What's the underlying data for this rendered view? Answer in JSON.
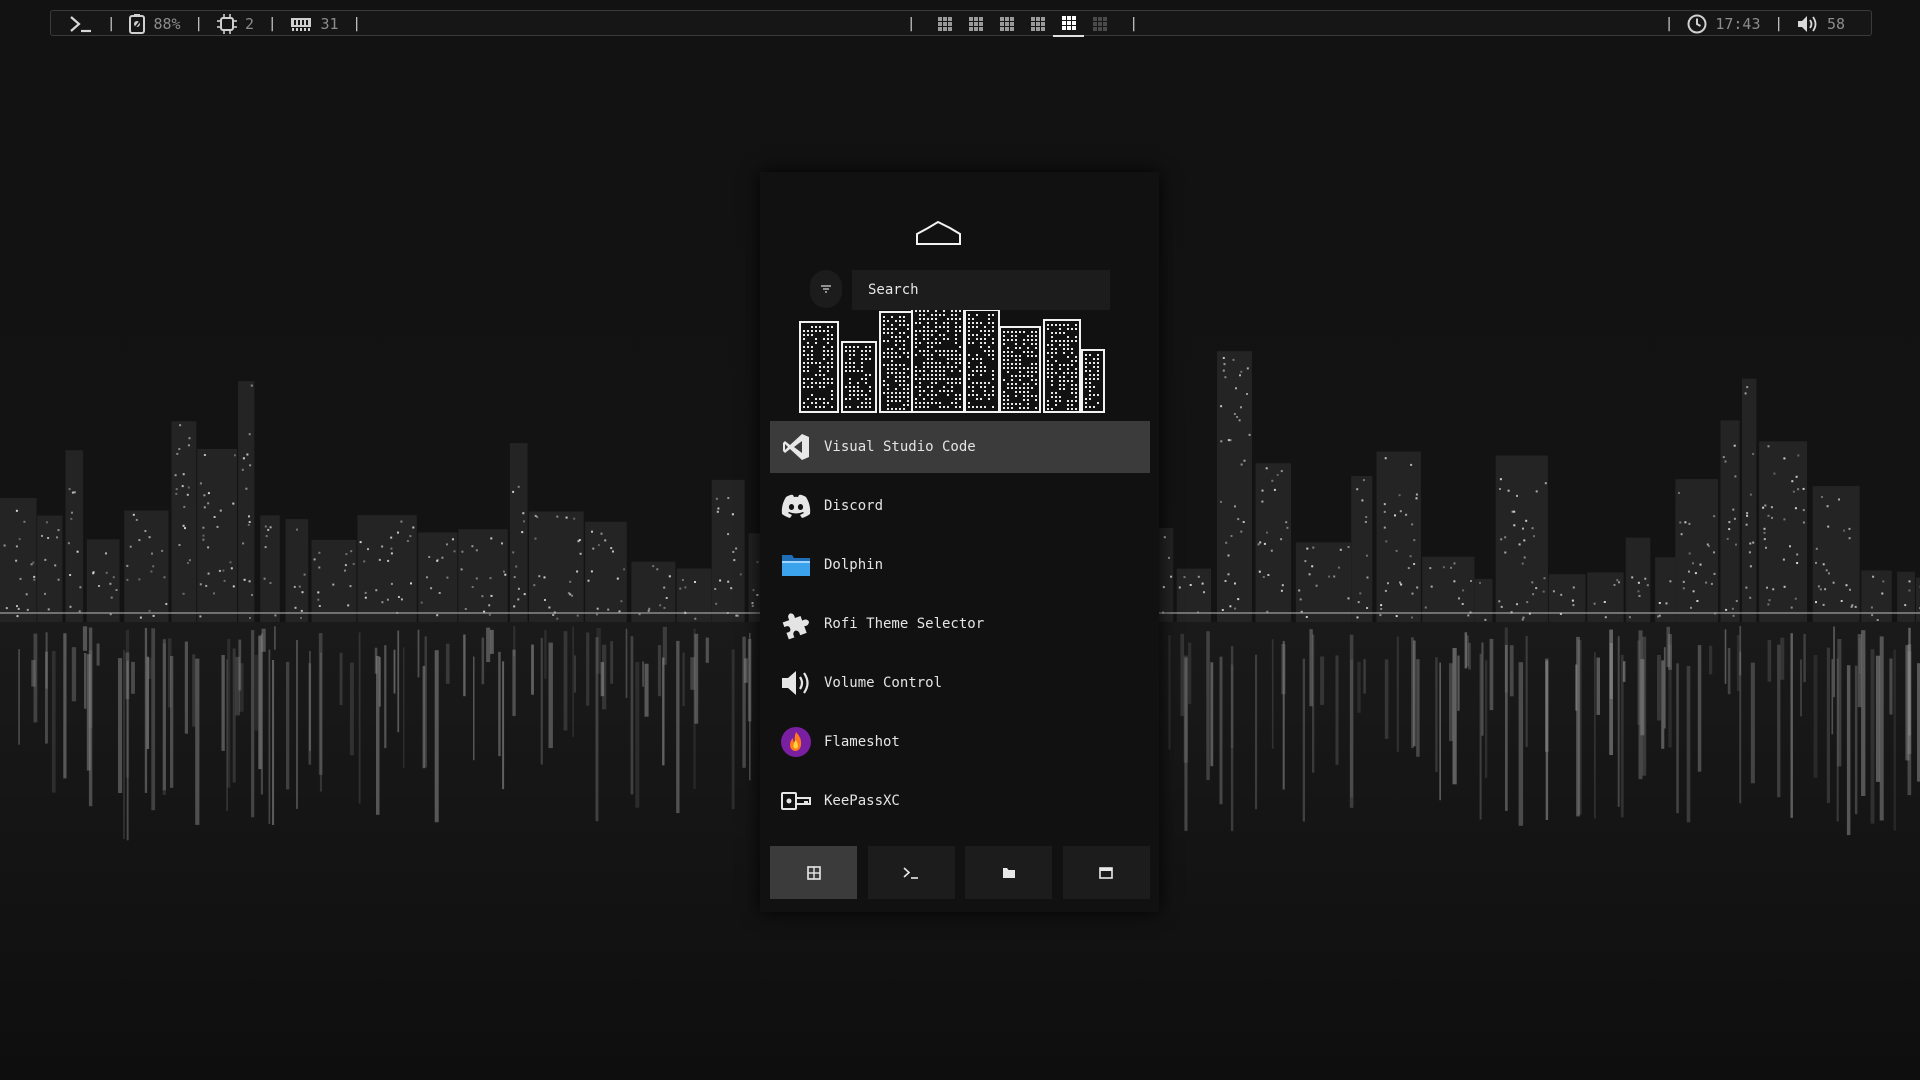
{
  "topbar": {
    "separator": "|",
    "terminal_icon": "terminal-prompt-icon",
    "battery": {
      "icon": "battery-icon",
      "value": "88%"
    },
    "cpu": {
      "icon": "cpu-chip-icon",
      "value": "2"
    },
    "memory": {
      "icon": "memory-ram-icon",
      "value": "31"
    },
    "workspaces": [
      {
        "icon": "workspace-grid-icon",
        "state": "normal"
      },
      {
        "icon": "workspace-grid-icon",
        "state": "normal"
      },
      {
        "icon": "workspace-grid-icon",
        "state": "normal"
      },
      {
        "icon": "workspace-grid-icon",
        "state": "normal"
      },
      {
        "icon": "workspace-grid-icon",
        "state": "active"
      },
      {
        "icon": "workspace-grid-icon",
        "state": "empty"
      }
    ],
    "clock": {
      "icon": "clock-icon",
      "value": "17:43"
    },
    "volume": {
      "icon": "speaker-icon",
      "value": "58"
    }
  },
  "launcher": {
    "search": {
      "placeholder": "Search",
      "value": ""
    },
    "filter_icon": "filter-icon",
    "items": [
      {
        "label": "Visual Studio Code",
        "icon": "vscode-icon",
        "selected": true
      },
      {
        "label": "Discord",
        "icon": "discord-icon",
        "selected": false
      },
      {
        "label": "Dolphin",
        "icon": "folder-icon",
        "selected": false
      },
      {
        "label": "Rofi Theme Selector",
        "icon": "puzzle-icon",
        "selected": false
      },
      {
        "label": "Volume Control",
        "icon": "speaker-icon",
        "selected": false
      },
      {
        "label": "Flameshot",
        "icon": "flameshot-icon",
        "selected": false
      },
      {
        "label": "KeePassXC",
        "icon": "key-icon",
        "selected": false
      }
    ],
    "modes": [
      {
        "icon": "apps-grid-icon",
        "active": true
      },
      {
        "icon": "terminal-icon",
        "active": false
      },
      {
        "icon": "folder-icon",
        "active": false
      },
      {
        "icon": "window-icon",
        "active": false
      }
    ]
  },
  "colors": {
    "background": "#0f0f0f",
    "bar_bg": "#161616",
    "launcher_bg": "#111111",
    "selected_bg": "#3b3b3b",
    "input_bg": "#1c1c1c",
    "text": "#e4e4e4",
    "discord": "#5865f2",
    "dolphin_blue": "#2a8ad8",
    "flameshot_purple": "#7b1fa2"
  }
}
